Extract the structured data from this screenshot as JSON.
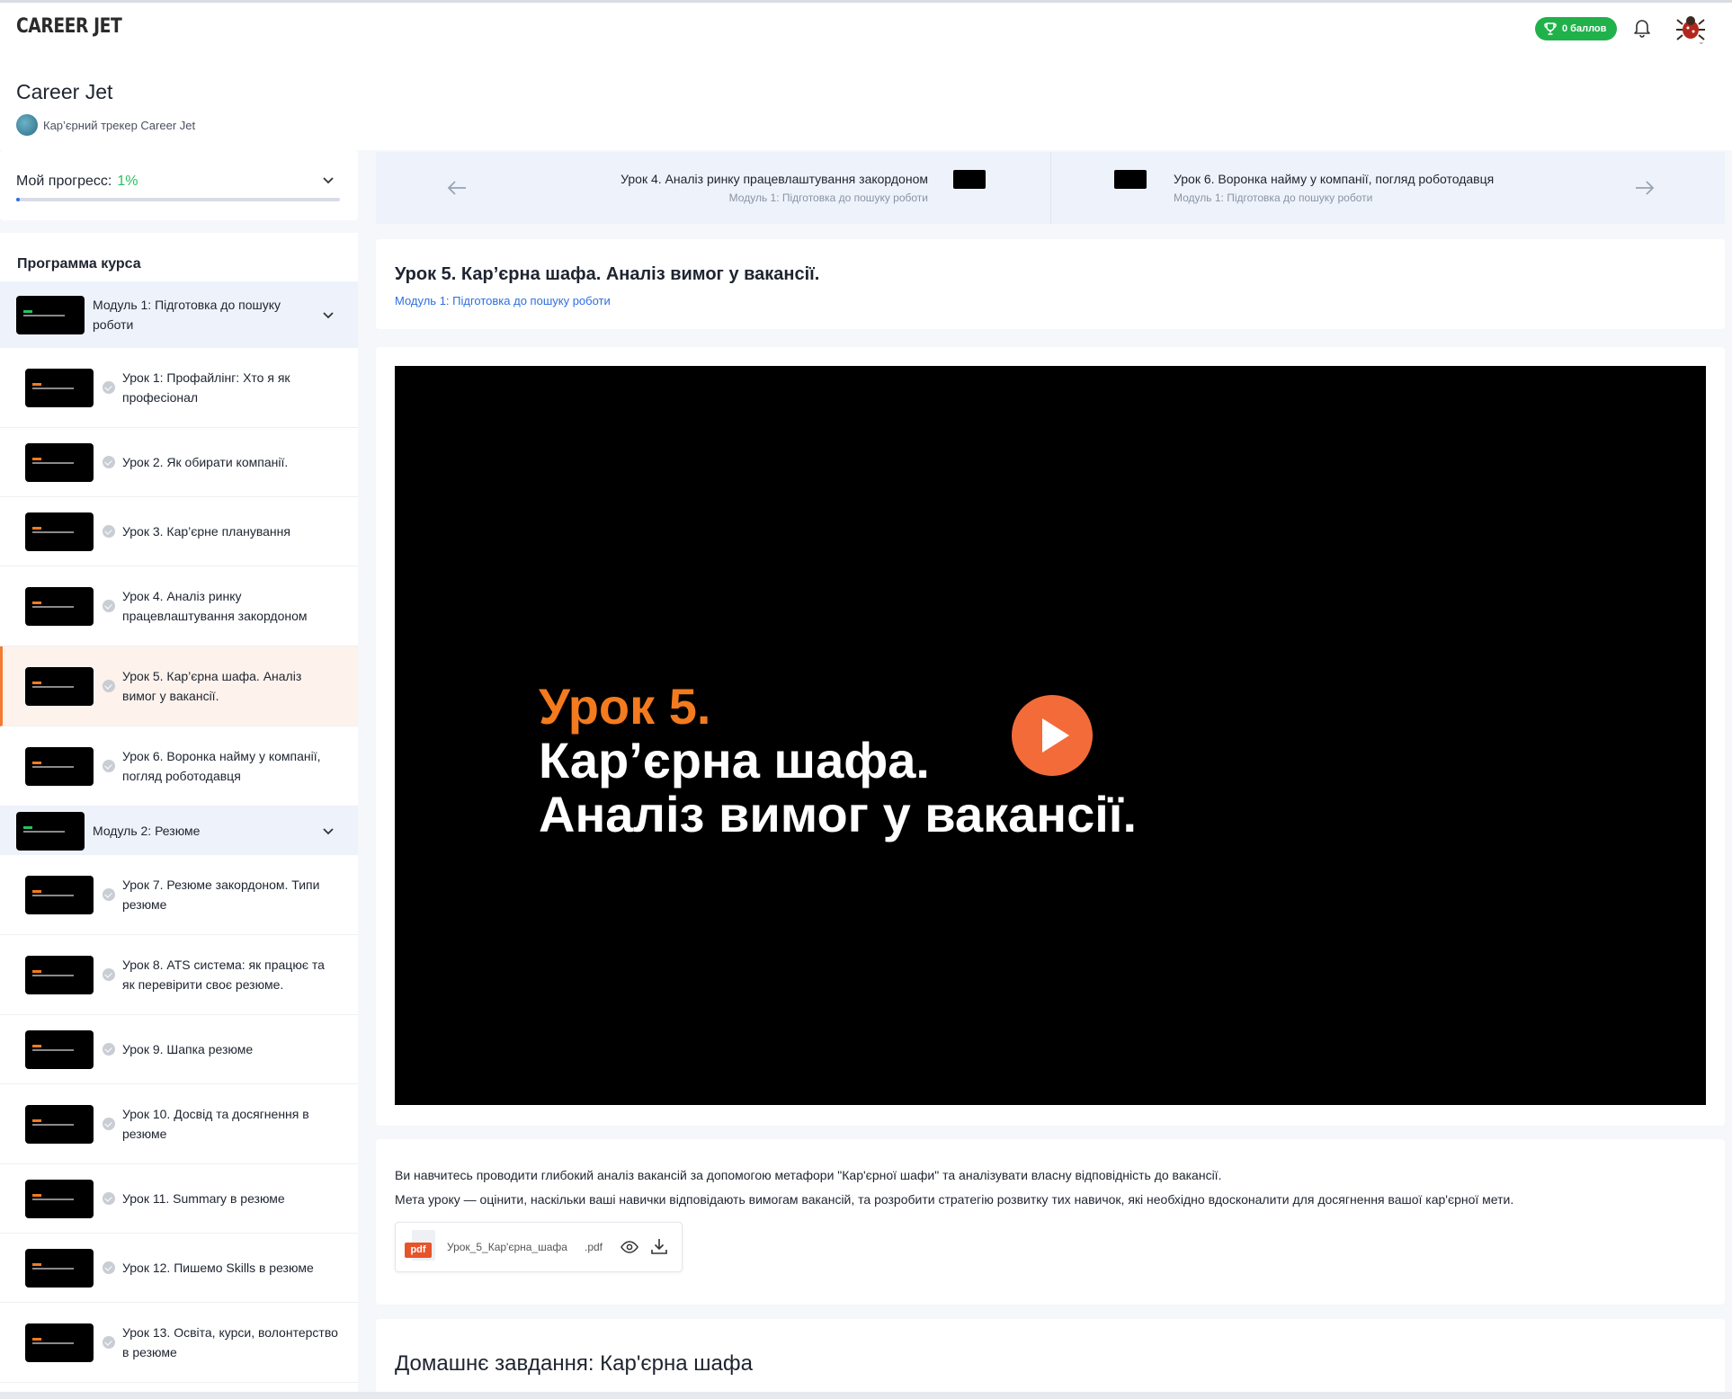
{
  "header": {
    "logo": "CAREER JET",
    "points_label": "0 баллов"
  },
  "course": {
    "title": "Career Jet",
    "subtitle": "Кар’єрний трекер Career Jet"
  },
  "progress": {
    "label": "Мой прогресс:",
    "percent_text": "1%",
    "value": 0.01
  },
  "program": {
    "title": "Программа курса",
    "module1": "Модуль 1: Підготовка до пошуку роботи",
    "module2": "Модуль 2: Резюме",
    "lessons": [
      "Урок 1: Профайлінг: Хто я як професіонал",
      "Урок 2. Як обирати компанії.",
      "Урок 3. Кар’єрне планування",
      "Урок 4. Аналіз ринку працевлаштування закордоном",
      "Урок 5. Кар’єрна шафа. Аналіз вимог у вакансії.",
      "Урок 6. Воронка найму у компанії, погляд роботодавця",
      "Урок 7. Резюме закордоном. Типи резюме",
      "Урок 8. ATS система: як працює та як перевірити своє резюме.",
      "Урок 9. Шапка резюме",
      "Урок 10. Досвід та досягнення в резюме",
      "Урок 11. Summary в резюме",
      "Урок 12. Пишемо Skills в резюме",
      "Урок 13. Освіта, курси, волонтерство в резюме"
    ]
  },
  "nav": {
    "prev_title": "Урок 4. Аналіз ринку працевлаштування закордоном",
    "prev_module": "Модуль 1: Підготовка до пошуку роботи",
    "next_title": "Урок 6. Воронка найму у компанії, погляд роботодавця",
    "next_module": "Модуль 1: Підготовка до пошуку роботи"
  },
  "lesson": {
    "title": "Урок 5. Кар’єрна шафа. Аналіз вимог у вакансії.",
    "module": "Модуль 1: Підготовка до пошуку роботи"
  },
  "video": {
    "line1": "Урок 5.",
    "line2": "Кар’єрна шафа.",
    "line3": "Аналіз вимог у вакансії."
  },
  "description": {
    "line1": "Ви навчитесь проводити глибокий аналіз вакансій за допомогою метафори \"Кар'єрної шафи\" та аналізувати власну відповідність до вакансії.",
    "line2": "Мета уроку — оцінити, наскільки ваші навички відповідають вимогам вакансій, та розробити стратегію розвитку тих навичок, які необхідно вдосконалити для досягнення вашої кар'єрної мети."
  },
  "file": {
    "icon_label": "pdf",
    "name": "Урок_5_Кар'єрна_шафа",
    "ext": ".pdf"
  },
  "homework": {
    "title": "Домашнє завдання: Кар'єрна шафа"
  },
  "colors": {
    "accent_orange": "#f47a2e",
    "green": "#21b14b",
    "blue": "#2e6fe0"
  }
}
